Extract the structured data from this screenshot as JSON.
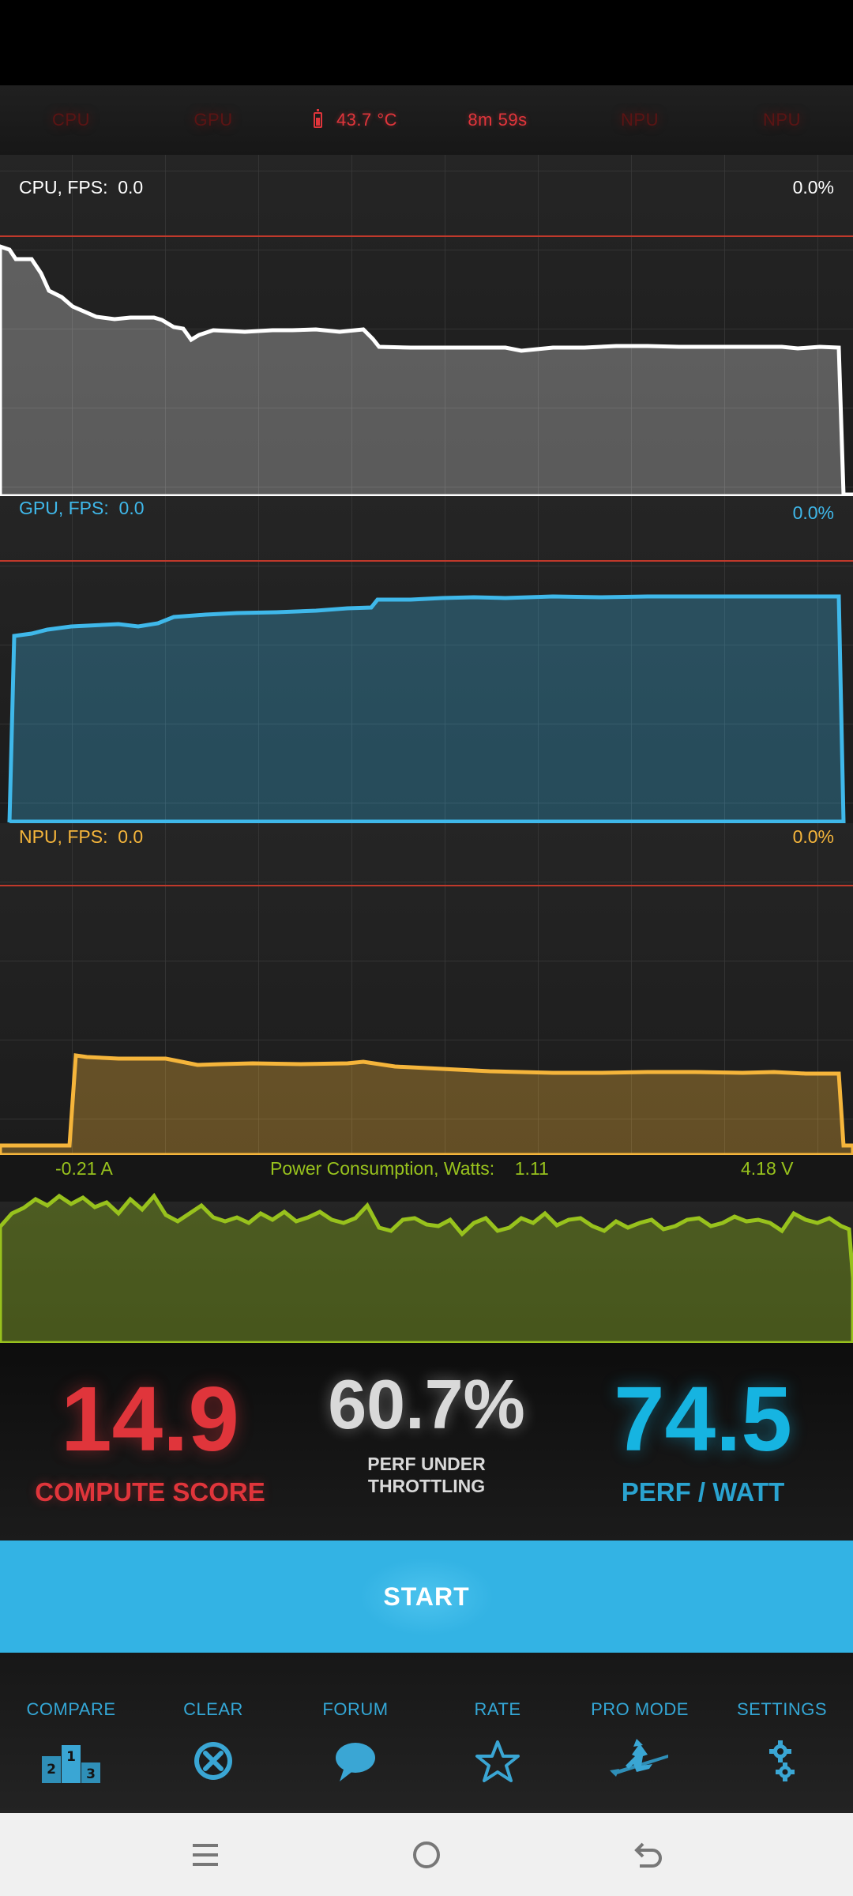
{
  "tabs": [
    {
      "label": "CPU",
      "active": false
    },
    {
      "label": "GPU",
      "active": false
    },
    {
      "label": "43.7 °C",
      "active": true,
      "icon": "battery-icon"
    },
    {
      "label": "8m 59s",
      "active": true
    },
    {
      "label": "NPU",
      "active": false
    },
    {
      "label": "NPU",
      "active": false
    }
  ],
  "graphs": {
    "cpu": {
      "label": "CPU, FPS:",
      "fps": "0.0",
      "percent": "0.0%",
      "color": "#ffffff"
    },
    "gpu": {
      "label": "GPU, FPS:",
      "fps": "0.0",
      "percent": "0.0%",
      "color": "#3fb8ea"
    },
    "npu": {
      "label": "NPU, FPS:",
      "fps": "0.0",
      "percent": "0.0%",
      "color": "#f5b53b"
    },
    "power": {
      "current": "-0.21 A",
      "label": "Power Consumption, Watts:",
      "watts": "1.11",
      "voltage": "4.18 V",
      "color": "#98c21d"
    }
  },
  "scores": {
    "compute": {
      "value": "14.9",
      "label": "COMPUTE SCORE",
      "color": "#e0353b"
    },
    "throttling": {
      "value": "60.7%",
      "label_line1": "PERF UNDER",
      "label_line2": "THROTTLING",
      "color": "#d9d9d9"
    },
    "perf_watt": {
      "value": "74.5",
      "label": "PERF / WATT",
      "color": "#16b4e1"
    }
  },
  "start_label": "START",
  "toolbar": [
    {
      "label": "COMPARE",
      "icon": "podium-icon"
    },
    {
      "label": "CLEAR",
      "icon": "clear-circle-icon"
    },
    {
      "label": "FORUM",
      "icon": "speech-bubble-icon"
    },
    {
      "label": "RATE",
      "icon": "star-icon"
    },
    {
      "label": "PRO MODE",
      "icon": "witch-icon"
    },
    {
      "label": "SETTINGS",
      "icon": "gear-icon"
    }
  ],
  "navbar": [
    {
      "icon": "menu-icon"
    },
    {
      "icon": "home-icon"
    },
    {
      "icon": "back-icon"
    }
  ]
}
